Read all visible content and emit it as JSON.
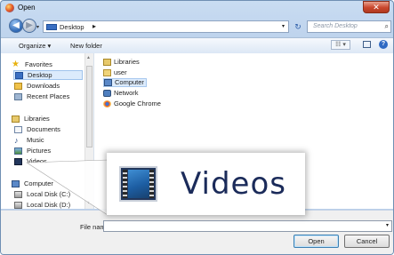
{
  "window": {
    "title": "Open",
    "close_glyph": "✕"
  },
  "nav": {
    "back_glyph": "◀",
    "forward_glyph": "▶",
    "address": "Desktop",
    "address_sep": "▸",
    "refresh_glyph": "↻",
    "search_placeholder": "Search Desktop"
  },
  "toolbar": {
    "organize_label": "Organize ▾",
    "new_folder_label": "New folder",
    "view_label": "☷ ▾",
    "help_label": "?"
  },
  "sidebar": {
    "items": [
      {
        "label": "Favorites",
        "icon": "star-icon"
      },
      {
        "label": "Desktop",
        "icon": "desktop-icon",
        "selected": true
      },
      {
        "label": "Downloads",
        "icon": "downloads-icon"
      },
      {
        "label": "Recent Places",
        "icon": "recent-places-icon"
      },
      {
        "label": "Libraries",
        "icon": "libraries-icon"
      },
      {
        "label": "Documents",
        "icon": "documents-icon"
      },
      {
        "label": "Music",
        "icon": "music-icon"
      },
      {
        "label": "Pictures",
        "icon": "pictures-icon"
      },
      {
        "label": "Videos",
        "icon": "videos-icon"
      },
      {
        "label": "Computer",
        "icon": "computer-icon"
      },
      {
        "label": "Local Disk (C:)",
        "icon": "drive-icon"
      },
      {
        "label": "Local Disk (D:)",
        "icon": "drive-icon"
      }
    ]
  },
  "files": [
    {
      "label": "Libraries",
      "icon": "libraries-icon"
    },
    {
      "label": "user",
      "icon": "user-folder-icon"
    },
    {
      "label": "Computer",
      "icon": "computer-icon",
      "selected": true
    },
    {
      "label": "Network",
      "icon": "network-icon"
    },
    {
      "label": "Google Chrome",
      "icon": "chrome-icon"
    }
  ],
  "bottom": {
    "file_name_label": "File name",
    "file_name_value": "",
    "open_label": "Open",
    "cancel_label": "Cancel"
  },
  "zoom": {
    "label": "Videos",
    "icon": "videos-icon"
  },
  "colors": {
    "selection": "#dcebfc",
    "chrome": "#b9cfea",
    "accent": "#2f68b4"
  }
}
